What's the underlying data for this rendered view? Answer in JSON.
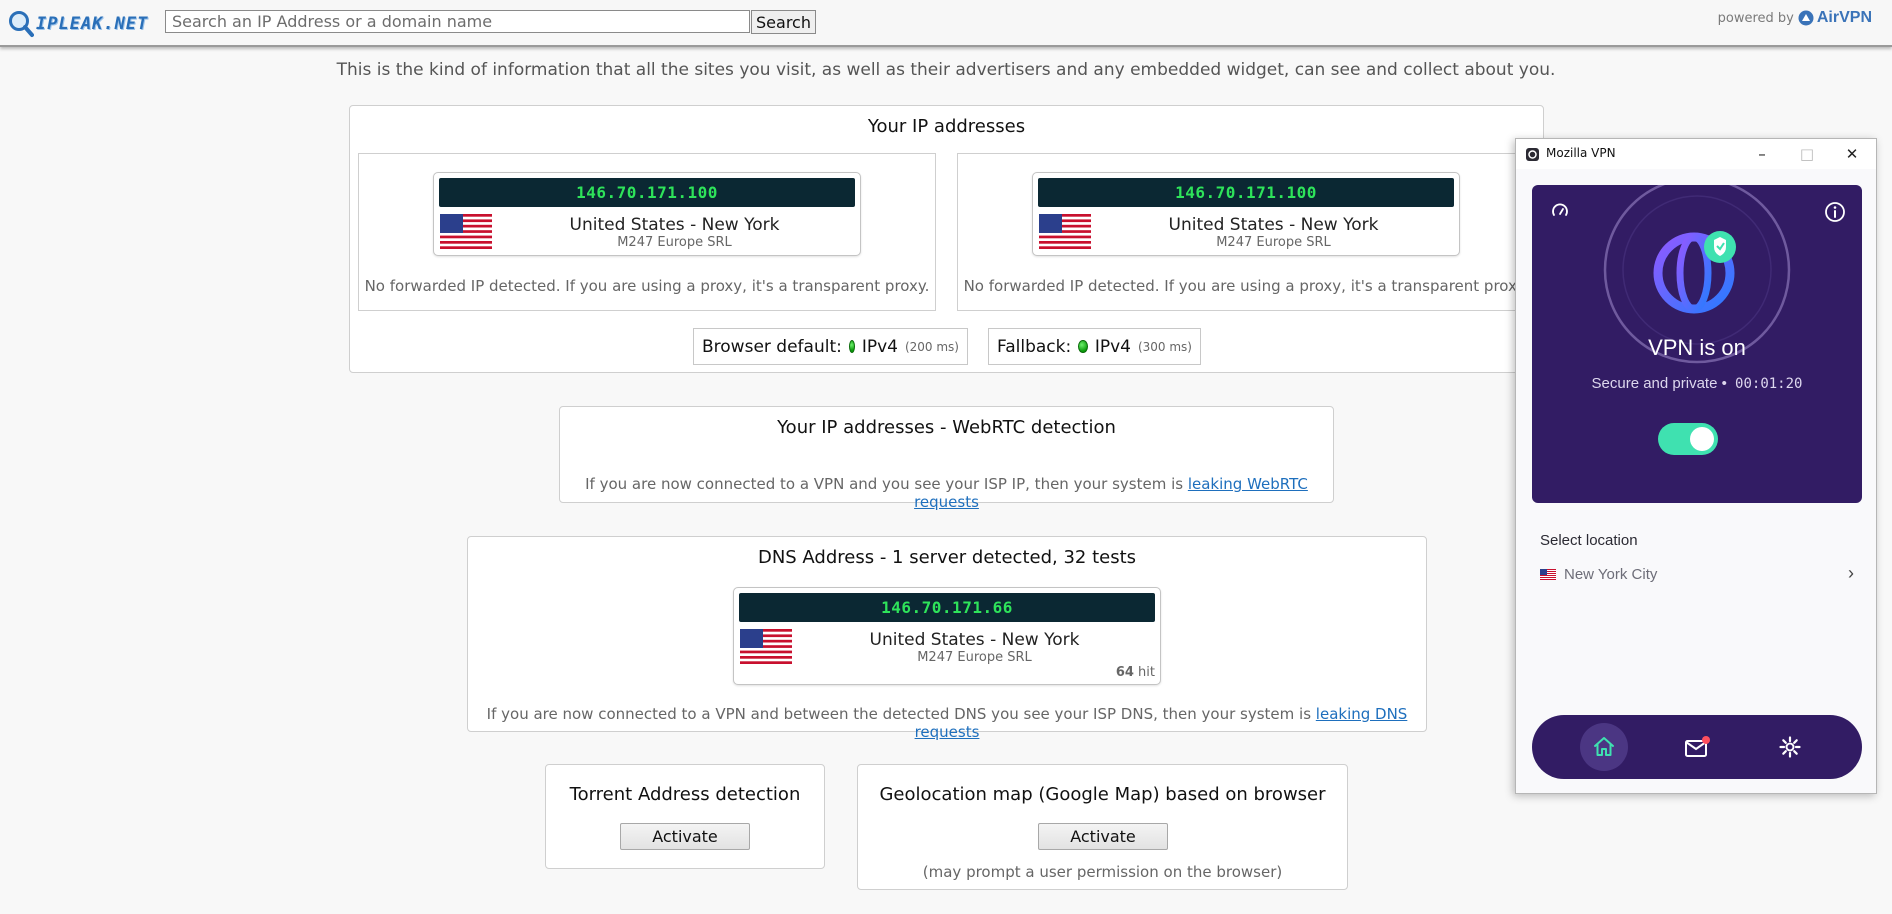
{
  "site": {
    "logo_text": "IPLEAK.NET",
    "search_placeholder": "Search an IP Address or a domain name",
    "search_button": "Search",
    "powered_by": "powered by",
    "powered_brand": "AirVPN"
  },
  "intro": "This is the kind of information that all the sites you visit, as well as their advertisers and any embedded widget, can see and collect about you.",
  "ip_section": {
    "title": "Your IP addresses",
    "entries": [
      {
        "ip": "146.70.171.100",
        "location": "United States - New York",
        "isp": "M247 Europe SRL",
        "note": "No forwarded IP detected. If you are using a proxy, it's a transparent proxy."
      },
      {
        "ip": "146.70.171.100",
        "location": "United States - New York",
        "isp": "M247 Europe SRL",
        "note": "No forwarded IP detected. If you are using a proxy, it's a transparent proxy."
      }
    ],
    "browser_default": {
      "label": "Browser default:",
      "proto": "IPv4",
      "ms": "(200 ms)"
    },
    "fallback": {
      "label": "Fallback:",
      "proto": "IPv4",
      "ms": "(300 ms)"
    }
  },
  "webrtc": {
    "title": "Your IP addresses - WebRTC detection",
    "note": "If you are now connected to a VPN and you see your ISP IP, then your system is",
    "link": "leaking WebRTC requests"
  },
  "dns": {
    "title": "DNS Address - 1 server detected, 32 tests",
    "ip": "146.70.171.66",
    "location": "United States - New York",
    "isp": "M247 Europe SRL",
    "hits_count": "64",
    "hits_label": "hit",
    "note": "If you are now connected to a VPN and between the detected DNS you see your ISP DNS, then your system is",
    "link": "leaking DNS requests"
  },
  "torrent": {
    "title": "Torrent Address detection",
    "button": "Activate"
  },
  "geo": {
    "title": "Geolocation map (Google Map) based on browser",
    "button": "Activate",
    "note": "(may prompt a user permission on the browser)"
  },
  "vpn_app": {
    "window_title": "Mozilla VPN",
    "status": "VPN is on",
    "subtitle": "Secure and private •",
    "timer": "00:01:20",
    "toggle_on": true,
    "select_location_label": "Select location",
    "location": "New York City",
    "colors": {
      "hero": "#321c64",
      "toggle": "#3fe1b0",
      "home_icon": "#3fe1b0"
    }
  }
}
